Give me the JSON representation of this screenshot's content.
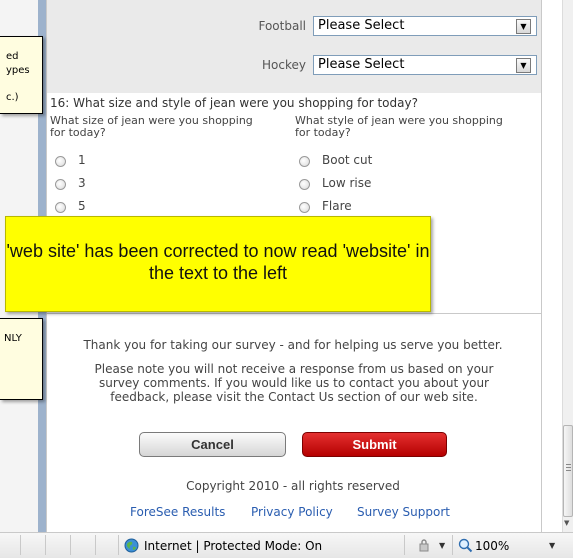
{
  "survey": {
    "rows": [
      {
        "label": "Football",
        "value": "Please Select"
      },
      {
        "label": "Hockey",
        "value": "Please Select"
      }
    ],
    "question": {
      "title": "16: What size and style of jean were you shopping for today?",
      "size_heading": "What size of jean were you shopping for today?",
      "style_heading": "What style of jean were you shopping for today?",
      "sizes": [
        "1",
        "3",
        "5"
      ],
      "styles": [
        "Boot cut",
        "Low rise",
        "Flare"
      ]
    },
    "thanks": "Thank you for taking our survey - and for helping us serve you better.",
    "note": "Please note you will not receive a response from us based on your survey comments. If you would like us to contact you about your feedback, please visit the Contact Us section of our web site.",
    "cancel_label": "Cancel",
    "submit_label": "Submit",
    "copyright": "Copyright 2010 - all rights reserved",
    "links": [
      "ForeSee Results",
      "Privacy Policy",
      "Survey Support"
    ]
  },
  "highlight_box": "'web site' has been corrected to now read 'website' in the text to the left",
  "side_notes": {
    "top_lines": [
      "ed",
      "ypes",
      "c.)"
    ],
    "bottom_text": "NLY"
  },
  "statusbar": {
    "zone_text": "Internet | Protected Mode: On",
    "zoom": "100%",
    "dropdown_arrow": "▼"
  }
}
